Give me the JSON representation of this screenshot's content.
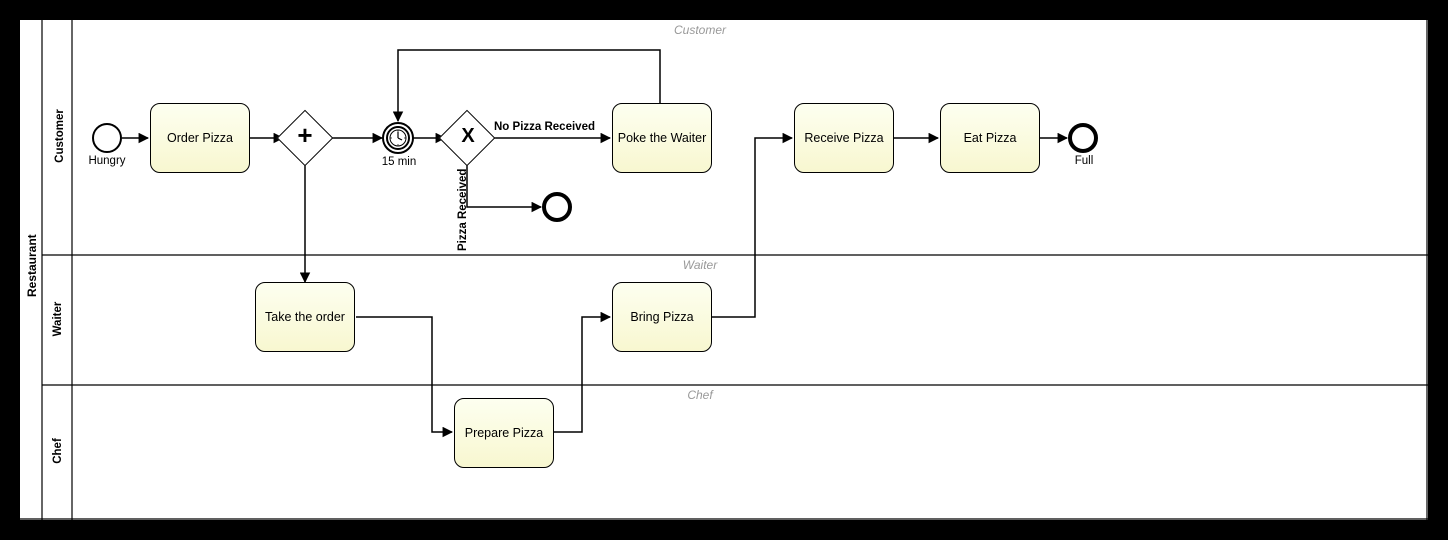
{
  "pool": {
    "title": "Restaurant"
  },
  "lanes": {
    "customer": {
      "label": "Customer",
      "watermark": "Customer"
    },
    "waiter": {
      "label": "Waiter",
      "watermark": "Waiter"
    },
    "chef": {
      "label": "Chef",
      "watermark": "Chef"
    }
  },
  "events": {
    "start": {
      "label": "Hungry"
    },
    "timer": {
      "label": "15 min"
    },
    "end_full": {
      "label": "Full"
    },
    "end_received": {
      "label": ""
    }
  },
  "gateways": {
    "parallel": {
      "symbol": "+"
    },
    "exclusive": {
      "symbol": "X"
    }
  },
  "tasks": {
    "order_pizza": {
      "label": "Order Pizza"
    },
    "poke_waiter": {
      "label": "Poke the Waiter"
    },
    "receive_pizza": {
      "label": "Receive Pizza"
    },
    "eat_pizza": {
      "label": "Eat Pizza"
    },
    "take_order": {
      "label": "Take the order"
    },
    "bring_pizza": {
      "label": "Bring Pizza"
    },
    "prepare_pizza": {
      "label": "Prepare Pizza"
    }
  },
  "flows": {
    "no_pizza": {
      "label": "No Pizza Received"
    },
    "pizza_recv": {
      "label": "Pizza Received"
    }
  }
}
